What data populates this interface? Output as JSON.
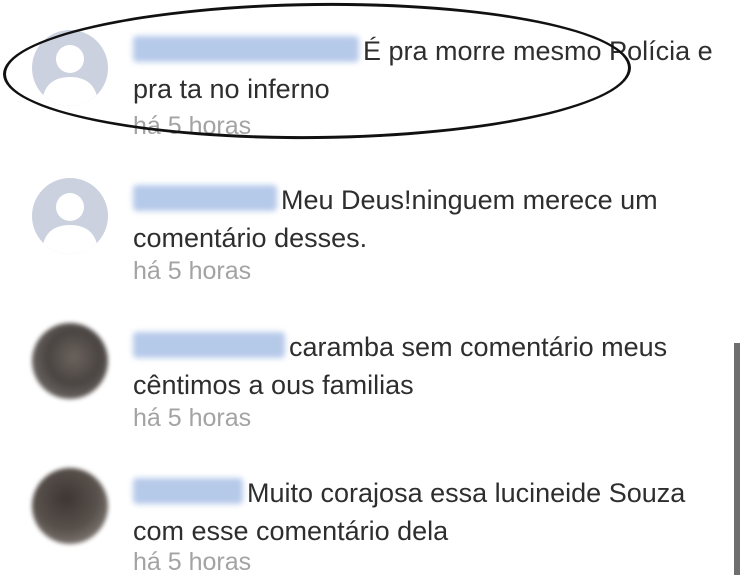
{
  "comments": [
    {
      "text": "É pra morre mesmo Polícia e pra ta no inferno",
      "time": "há 5 horas"
    },
    {
      "text": "Meu Deus!ninguem merece um comentário desses.",
      "time": "há 5 horas"
    },
    {
      "text": "caramba sem comentário meus cêntimos a ous familias",
      "time": "há 5 horas"
    },
    {
      "text": "Muito corajosa essa lucineide Souza com esse comentário dela",
      "time": "há 5 horas"
    }
  ]
}
